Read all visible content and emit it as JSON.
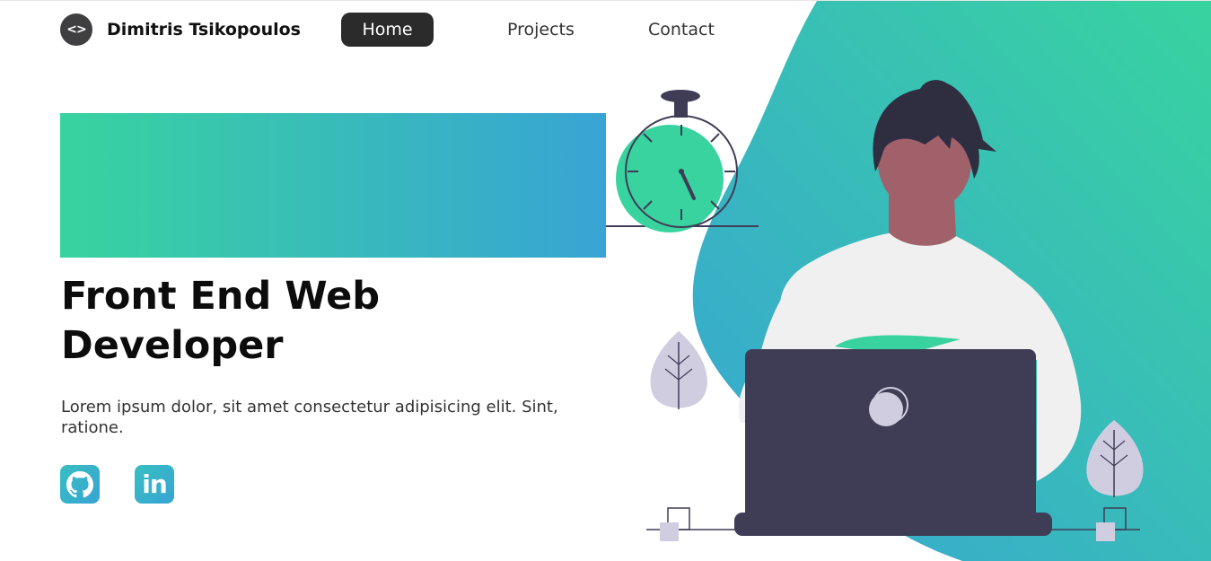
{
  "nav": {
    "logo_glyph": "<>",
    "brand": "Dimitris Tsikopoulos",
    "links": [
      {
        "label": "Home",
        "active": true
      },
      {
        "label": "Projects",
        "active": false
      },
      {
        "label": "Contact",
        "active": false
      }
    ]
  },
  "hero": {
    "title": "Front End Web Developer",
    "text": "Lorem ipsum dolor, sit amet consectetur adipisicing elit. Sint, ratione.",
    "gradient": [
      "#38d39f",
      "#38a4d4"
    ]
  },
  "social": {
    "linkedin_label": "in",
    "items": [
      {
        "icon": "github-icon"
      },
      {
        "icon": "linkedin-icon"
      }
    ]
  },
  "colors": {
    "green": "#38d39f",
    "blue": "#38a4d4",
    "dark": "#2b2b2b",
    "laptop": "#3f3d56"
  }
}
